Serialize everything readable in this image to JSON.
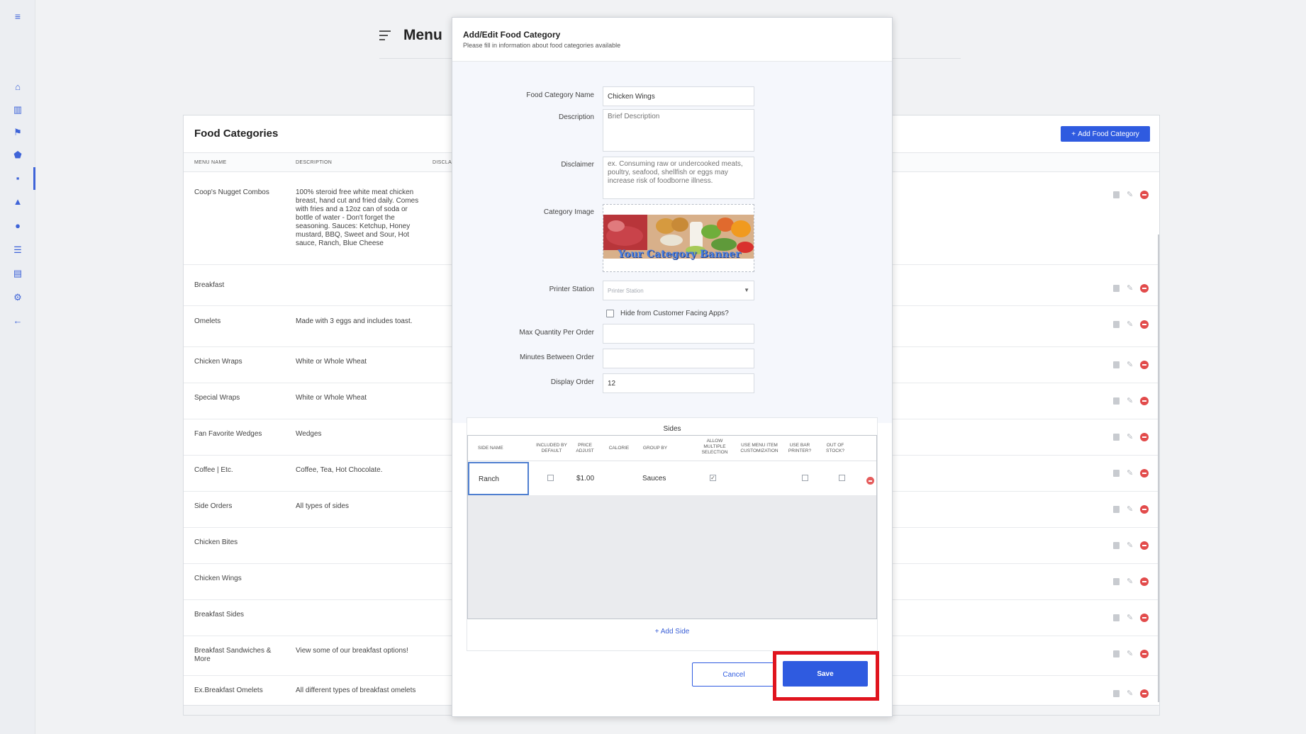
{
  "page": {
    "title": "Menu"
  },
  "sidebar": {
    "icons": [
      "menu-icon",
      "home-icon",
      "chart-icon",
      "flag-icon",
      "tag-icon",
      "menu-list-icon",
      "chef-icon",
      "user-icon",
      "reports-icon",
      "list-icon",
      "gear-icon",
      "back-arrow-icon"
    ]
  },
  "card": {
    "title": "Food Categories",
    "add_button": "Add Food Category",
    "columns": [
      "MENU NAME",
      "DESCRIPTION",
      "DISCLA"
    ],
    "rows": [
      {
        "name": "Coop's Nugget Combos",
        "description": "100% steroid free white meat chicken breast, hand cut and fried daily. Comes with fries and a 12oz can of soda or bottle of water - Don't forget the seasoning. Sauces: Ketchup, Honey mustard, BBQ, Sweet and Sour, Hot sauce, Ranch, Blue Cheese"
      },
      {
        "name": "Breakfast",
        "description": ""
      },
      {
        "name": "Omelets",
        "description": "Made with 3 eggs and includes toast."
      },
      {
        "name": "Chicken Wraps",
        "description": "White or Whole Wheat"
      },
      {
        "name": "Special Wraps",
        "description": "White or Whole Wheat"
      },
      {
        "name": "Fan Favorite Wedges",
        "description": "Wedges"
      },
      {
        "name": "Coffee | Etc.",
        "description": "Coffee, Tea, Hot Chocolate."
      },
      {
        "name": "Side Orders",
        "description": "All types of sides"
      },
      {
        "name": "Chicken Bites",
        "description": ""
      },
      {
        "name": "Chicken Wings",
        "description": ""
      },
      {
        "name": "Breakfast Sides",
        "description": ""
      },
      {
        "name": "Breakfast Sandwiches & More",
        "description": "View some of our breakfast options!"
      },
      {
        "name": "Ex.Breakfast Omelets",
        "description": "All different types of breakfast omelets"
      }
    ]
  },
  "modal": {
    "title": "Add/Edit Food Category",
    "subtitle": "Please fill in information about food categories available",
    "labels": {
      "name": "Food Category Name",
      "description": "Description",
      "disclaimer": "Disclaimer",
      "image": "Category Image",
      "printer": "Printer Station",
      "hide": "Hide from Customer Facing Apps?",
      "max_qty": "Max Quantity Per Order",
      "minutes": "Minutes Between Order",
      "display_order": "Display Order"
    },
    "values": {
      "name": "Chicken Wings",
      "description_placeholder": "Brief Description",
      "disclaimer_placeholder": "ex. Consuming raw or undercooked meats, poultry, seafood, shellfish or eggs may increase risk of foodborne illness.",
      "printer_placeholder": "Printer Station",
      "max_qty": "",
      "minutes": "",
      "display_order": "12",
      "hide_checked": false
    },
    "image_banner_text": "Your Category Banner",
    "sides": {
      "title": "Sides",
      "headers": [
        "SIDE NAME",
        "INCLUDED BY DEFAULT",
        "PRICE ADJUST",
        "CALORIE",
        "GROUP BY",
        "ALLOW MULTIPLE SELECTION",
        "USE MENU ITEM CUSTOMIZATION",
        "USE BAR PRINTER?",
        "OUT OF STOCK?"
      ],
      "rows": [
        {
          "name": "Ranch",
          "included_by_default": false,
          "price_adjust": "$1.00",
          "calorie": "",
          "group_by": "Sauces",
          "allow_multiple": true,
          "use_bar_printer": false,
          "out_of_stock": false
        }
      ],
      "add_label": "Add Side"
    },
    "cancel": "Cancel",
    "save": "Save"
  },
  "colors": {
    "accent": "#2f5be0",
    "highlight": "#e0141e",
    "danger": "#e24b4b"
  }
}
